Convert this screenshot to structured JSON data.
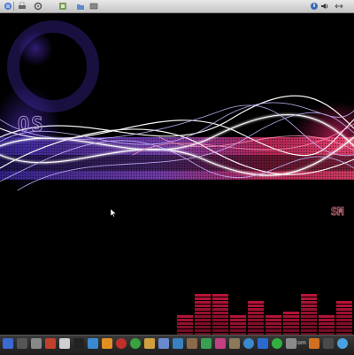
{
  "top_panel": {
    "left_icons": [
      "menu-icon",
      "printer-icon",
      "settings-icon",
      "network-icon",
      "folder-icon",
      "window-icon"
    ],
    "right_icons": [
      "update-icon",
      "volume-icon",
      "network-status-icon"
    ]
  },
  "wallpaper": {
    "logo_text": "OS",
    "side_text": "SM",
    "colors": {
      "purple": "#6a3cff",
      "pink": "#ff2a7a",
      "red": "#c0143a"
    },
    "equalizer_levels": [
      0.31,
      0.64,
      0.64,
      0.31,
      0.52,
      0.31,
      0.37,
      0.64,
      0.31,
      0.52
    ]
  },
  "dock": {
    "label": "com",
    "items": [
      "terminal-icon",
      "monitor-icon",
      "settings-icon",
      "photo-icon",
      "printer-icon",
      "terminal2-icon",
      "mascot-icon",
      "bird-icon",
      "opera-icon",
      "clock-icon",
      "tools-icon",
      "media-player-icon",
      "shield-icon",
      "archive-icon",
      "leaf-icon",
      "ebook-icon",
      "gimp-icon",
      "chat-icon",
      "pen-icon",
      "skype-icon",
      "paint-icon",
      "guitar-icon",
      "clapper-icon",
      "play-icon"
    ]
  }
}
